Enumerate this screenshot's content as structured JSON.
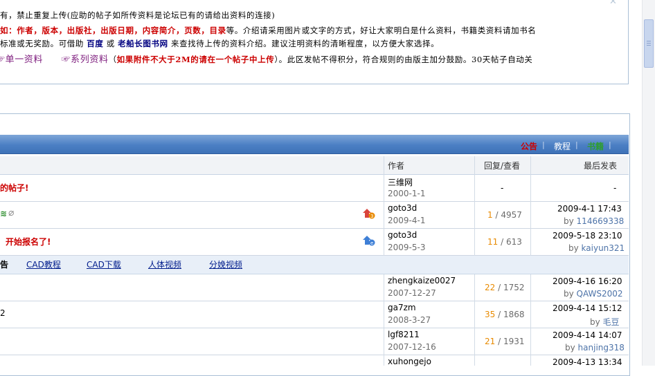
{
  "rules": {
    "line1": "有，禁止重复上传(应助的帖子如所传资料是论坛已有的请给出资料的连接)",
    "line2_red": "如：作者，版本，出版社，出版日期，内容简介，页数，目录",
    "line2_rest": "等。介绍请采用图片或文字的方式，好让大家明白是什么资料，书籍类资料请加书名",
    "line3_a": "标准或无奖励。可借助",
    "line3_baidu": "百度",
    "line3_or": "或",
    "line3_shushu": "老船长图书网",
    "line3_rest": "来查找待上传的资料介绍。建议注明资料的清晰程度，以方便大家选择。",
    "single_label": "单一资料",
    "series_label": "系列资料",
    "paren_open": "（",
    "attach_note": "如果附件不大于2M的请在一个帖子中上传",
    "line4_rest": "）。此区发帖不得积分，符合规则的由版主加分鼓励。30天帖子自动关"
  },
  "titlebar": {
    "announce": "公告",
    "tutorial": "教程",
    "books": "书籍",
    "sep": "|",
    "accent": "#cc0000",
    "books_color": "#2e9e2e"
  },
  "table": {
    "headers": {
      "author": "作者",
      "replies": "回复/查看",
      "last_post": "最后发表"
    },
    "rows": [
      {
        "title": "的帖子!",
        "author": "三维网",
        "date": "2000-1-1",
        "replies": "-",
        "views": "",
        "last_time": "-",
        "last_by": "",
        "by_prefix": ""
      },
      {
        "title": "",
        "author": "goto3d",
        "date": "2009-4-1",
        "replies": "1",
        "views": "/ 4957",
        "last_time": "2009-4-1 17:43",
        "last_by": "114669338",
        "by_prefix": "by"
      },
      {
        "title": "开始报名了!",
        "author": "goto3d",
        "date": "2009-5-3",
        "replies": "11",
        "views": "/ 613",
        "last_time": "2009-5-18 23:10",
        "last_by": "kaiyun321",
        "by_prefix": "by"
      },
      {
        "title": "",
        "author": "zhengkaize0027",
        "date": "2007-12-27",
        "replies": "22",
        "views": "/ 1752",
        "last_time": "2009-4-16 16:20",
        "last_by": "QAWS2002",
        "by_prefix": "by"
      },
      {
        "title": "2",
        "author": "ga7zm",
        "date": "2008-3-27",
        "replies": "35",
        "views": "/ 1868",
        "last_time": "2009-4-14 15:12",
        "last_by": "毛豆",
        "by_prefix": "by"
      },
      {
        "title": "",
        "author": "lgf8211",
        "date": "2007-12-16",
        "replies": "21",
        "views": "/ 1931",
        "last_time": "2009-4-14 14:07",
        "last_by": "hanjing318",
        "by_prefix": "by"
      },
      {
        "title": "",
        "author": "xuhongejo",
        "date": "",
        "replies": "",
        "views": "",
        "last_time": "2009-4-13 13:34",
        "last_by": "",
        "by_prefix": ""
      }
    ],
    "subbar": {
      "prefix": "告",
      "tabs": [
        "CAD教程",
        "CAD下载",
        "人体视频",
        "分娩视频"
      ]
    }
  }
}
